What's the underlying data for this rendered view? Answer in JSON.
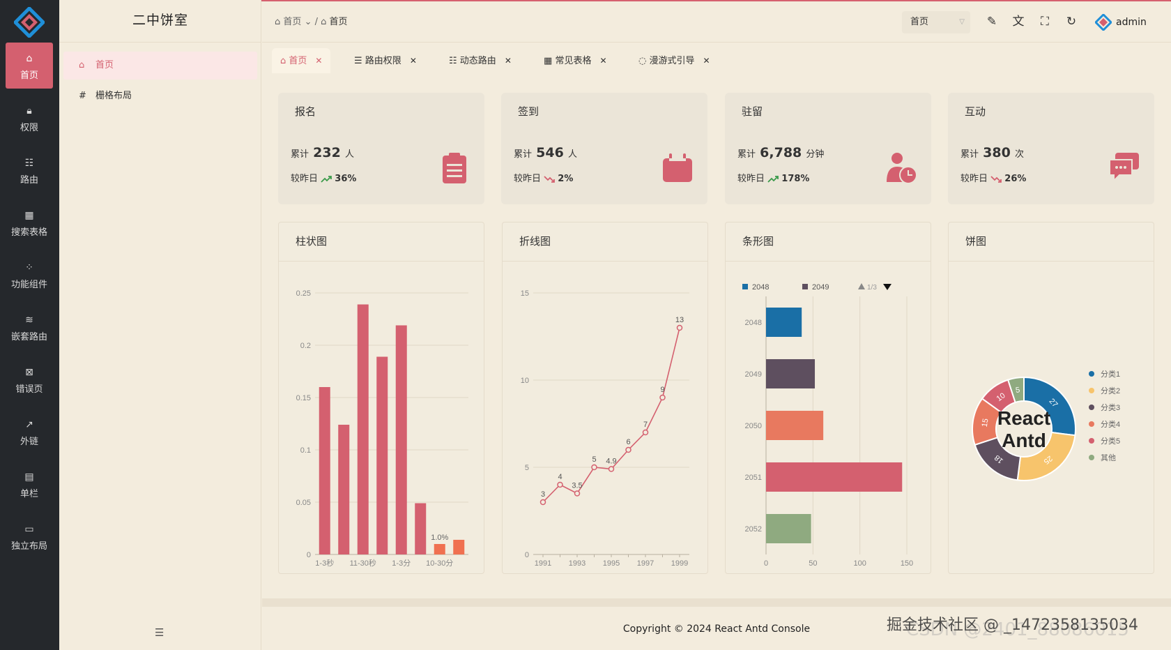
{
  "app": {
    "brand": "二中饼室",
    "user": "admin"
  },
  "rail": [
    {
      "label": "首页",
      "icon": "home-icon",
      "active": true
    },
    {
      "label": "权限",
      "icon": "lock-icon"
    },
    {
      "label": "路由",
      "icon": "route-icon"
    },
    {
      "label": "搜索表格",
      "icon": "table-search-icon"
    },
    {
      "label": "功能组件",
      "icon": "components-icon"
    },
    {
      "label": "嵌套路由",
      "icon": "nested-icon"
    },
    {
      "label": "错误页",
      "icon": "error-icon"
    },
    {
      "label": "外链",
      "icon": "external-link-icon"
    },
    {
      "label": "单栏",
      "icon": "single-column-icon"
    },
    {
      "label": "独立布局",
      "icon": "layout-icon"
    }
  ],
  "submenu": [
    {
      "label": "首页",
      "icon": "home-icon",
      "active": true
    },
    {
      "label": "栅格布局",
      "icon": "grid-icon"
    }
  ],
  "breadcrumb": {
    "first": "首页",
    "current": "首页"
  },
  "header": {
    "select_value": "首页"
  },
  "tabs": [
    {
      "label": "首页",
      "icon": "home-icon",
      "active": true
    },
    {
      "label": "路由权限",
      "icon": "menu-icon"
    },
    {
      "label": "动态路由",
      "icon": "list-icon"
    },
    {
      "label": "常见表格",
      "icon": "table-icon"
    },
    {
      "label": "漫游式引导",
      "icon": "bulb-icon"
    }
  ],
  "stats": [
    {
      "title": "报名",
      "total_label": "累计",
      "value": "232",
      "unit": "人",
      "cmp_label": "较昨日",
      "trend": "up",
      "percent": "36%",
      "icon": "clipboard-icon",
      "color": "#d4606f"
    },
    {
      "title": "签到",
      "total_label": "累计",
      "value": "546",
      "unit": "人",
      "cmp_label": "较昨日",
      "trend": "down",
      "percent": "2%",
      "icon": "calendar-icon",
      "color": "#d4606f"
    },
    {
      "title": "驻留",
      "total_label": "累计",
      "value": "6,788",
      "unit": "分钟",
      "cmp_label": "较昨日",
      "trend": "up",
      "percent": "178%",
      "icon": "user-clock-icon",
      "color": "#d4606f"
    },
    {
      "title": "互动",
      "total_label": "累计",
      "value": "380",
      "unit": "次",
      "cmp_label": "较昨日",
      "trend": "down",
      "percent": "26%",
      "icon": "chat-icon",
      "color": "#d4606f"
    }
  ],
  "panels": {
    "bar": "柱状图",
    "line": "折线图",
    "hbar": "条形图",
    "pie": "饼图"
  },
  "chart_data": [
    {
      "type": "bar",
      "title": "柱状图",
      "categories": [
        "1-3秒",
        "",
        "11-30秒",
        "",
        "1-3分",
        "",
        "10-30分",
        ""
      ],
      "values": [
        0.16,
        0.124,
        0.239,
        0.189,
        0.219,
        0.049,
        0.01,
        0.014
      ],
      "colors": [
        "#d4606f",
        "#d4606f",
        "#d4606f",
        "#d4606f",
        "#d4606f",
        "#d4606f",
        "#f07050",
        "#f07050"
      ],
      "data_labels": [
        "",
        "",
        "",
        "",
        "",
        "",
        "1.0%",
        ""
      ],
      "yticks": [
        "0",
        "0.05",
        "0.1",
        "0.15",
        "0.2",
        "0.25"
      ],
      "ylim": [
        0,
        0.25
      ]
    },
    {
      "type": "line",
      "title": "折线图",
      "x": [
        1991,
        1992,
        1993,
        1994,
        1995,
        1996,
        1997,
        1998,
        1999
      ],
      "y": [
        3,
        4,
        3.5,
        5,
        4.9,
        6,
        7,
        9,
        13
      ],
      "labels": [
        "3",
        "4",
        "3.5",
        "5",
        "4.9",
        "6",
        "7",
        "9",
        "13"
      ],
      "xticks": [
        "1991",
        "1993",
        "1995",
        "1997",
        "1999"
      ],
      "yticks": [
        "0",
        "5",
        "10",
        "15"
      ],
      "ylim": [
        0,
        15
      ],
      "color": "#d4606f"
    },
    {
      "type": "bar",
      "orientation": "horizontal",
      "title": "条形图",
      "categories": [
        "2048",
        "2049",
        "2050",
        "2051",
        "2052"
      ],
      "values": [
        38,
        52,
        61,
        145,
        48
      ],
      "colors": [
        "#1a6fa6",
        "#5e4f5f",
        "#e8795f",
        "#d4606f",
        "#8faa80"
      ],
      "legend": [
        {
          "name": "2048",
          "color": "#1a6fa6"
        },
        {
          "name": "2049",
          "color": "#5e4f5f"
        }
      ],
      "legend_pager": "1/3",
      "xticks": [
        "0",
        "50",
        "100",
        "150"
      ],
      "xlim": [
        0,
        150
      ]
    },
    {
      "type": "pie",
      "title": "饼图",
      "center_text": [
        "React",
        "Antd"
      ],
      "slices": [
        {
          "name": "分类1",
          "value": 27,
          "color": "#1a6fa6"
        },
        {
          "name": "分类2",
          "value": 25,
          "color": "#f7c46c"
        },
        {
          "name": "分类3",
          "value": 18,
          "color": "#5e4f5f"
        },
        {
          "name": "分类4",
          "value": 15,
          "color": "#e8795f"
        },
        {
          "name": "分类5",
          "value": 10,
          "color": "#d4606f"
        },
        {
          "name": "其他",
          "value": 5,
          "color": "#8faa80"
        }
      ]
    }
  ],
  "footer": {
    "copyright": "Copyright © 2024 React Antd Console"
  },
  "watermark": {
    "line1": "掘金技术社区 @ _1472358135034",
    "line2": "CSDN @2401_88086015"
  }
}
